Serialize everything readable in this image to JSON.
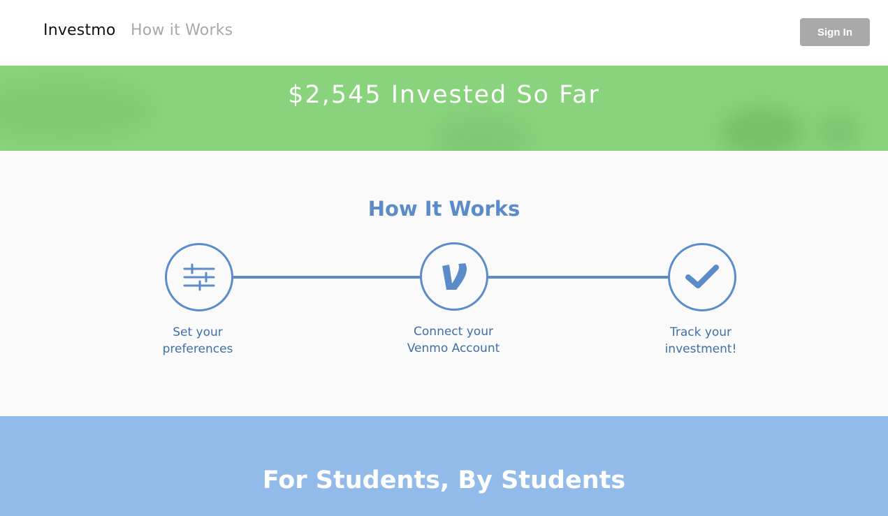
{
  "navbar": {
    "brand": "Investmo",
    "how_it_works_link": "How it Works",
    "sign_in_label": "Sign In"
  },
  "banner": {
    "title": "$2,545 Invested So Far"
  },
  "how_it_works": {
    "title": "How It Works",
    "steps": [
      {
        "icon": "sliders-icon",
        "line1": "Set your",
        "line2": "preferences"
      },
      {
        "icon": "venmo-logo-icon",
        "line1": "Connect your",
        "line2": "Venmo Account"
      },
      {
        "icon": "checkmark-icon",
        "line1": "Track your",
        "line2": "investment!"
      }
    ]
  },
  "students": {
    "title": "For Students, By Students"
  },
  "colors": {
    "banner_green": "#89d37c",
    "accent_blue": "#5b8bc9",
    "students_blue": "#93bbea",
    "button_gray": "#a9a9a9"
  }
}
